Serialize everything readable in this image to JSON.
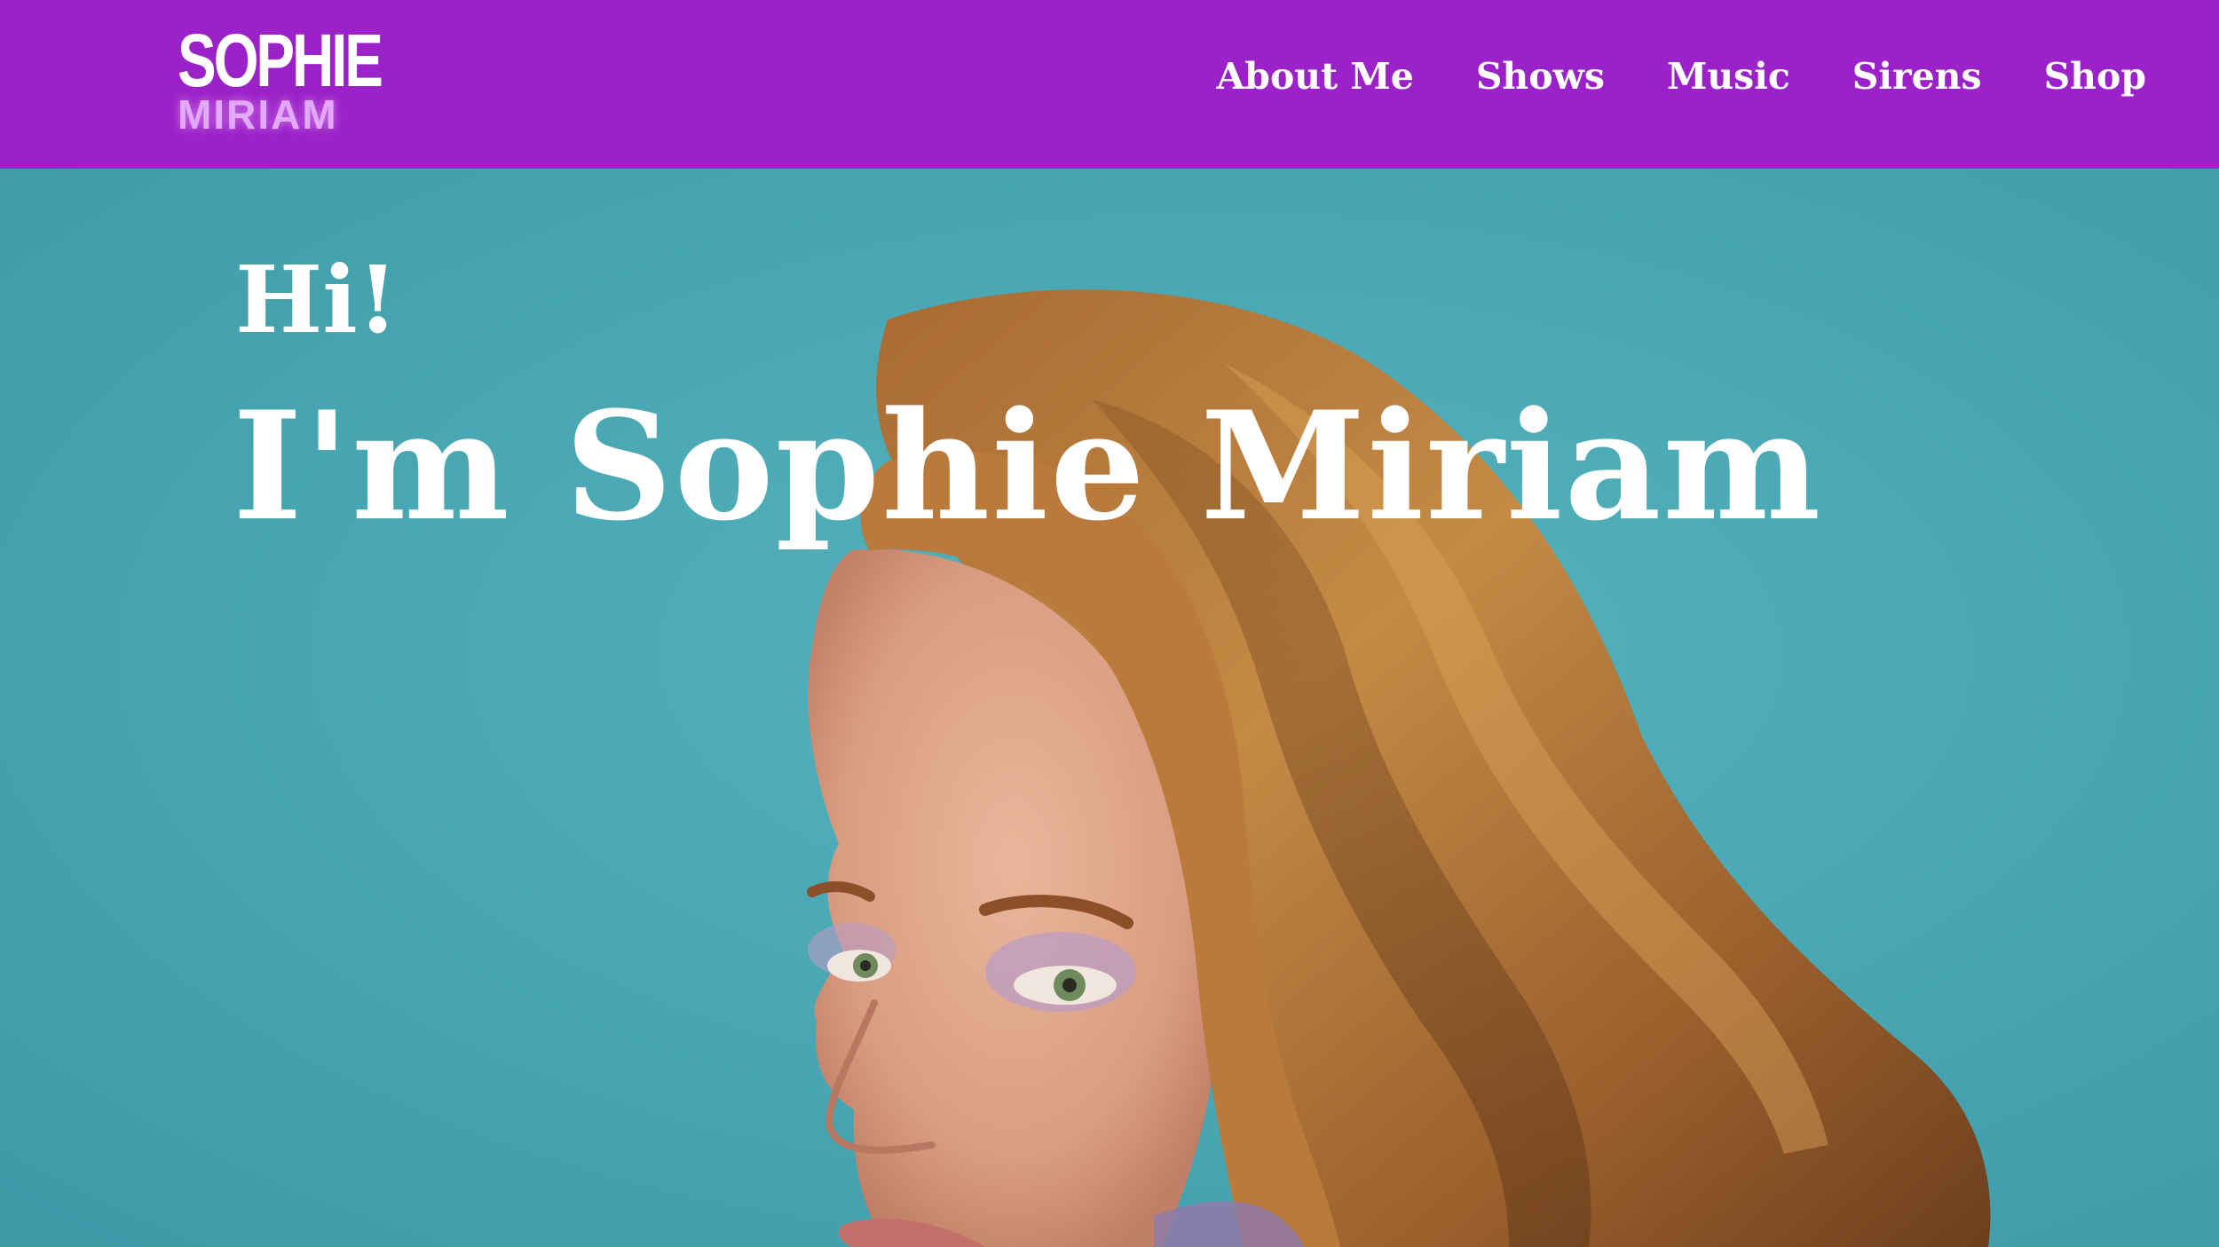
{
  "header": {
    "logo": {
      "line1": "SOPHIE",
      "line2": "MIRIAM"
    },
    "nav": [
      {
        "label": "About Me"
      },
      {
        "label": "Shows"
      },
      {
        "label": "Music"
      },
      {
        "label": "Sirens"
      },
      {
        "label": "Shop"
      }
    ]
  },
  "hero": {
    "greeting": "Hi!",
    "headline": "I'm Sophie Miriam",
    "photo_subject": "portrait of woman with curly auburn hair over shoulder"
  },
  "colors": {
    "header_bg": "#9b22c9",
    "hero_bg": "#4aa8b4",
    "logo_accent": "#e2a9ff",
    "text": "#ffffff"
  }
}
